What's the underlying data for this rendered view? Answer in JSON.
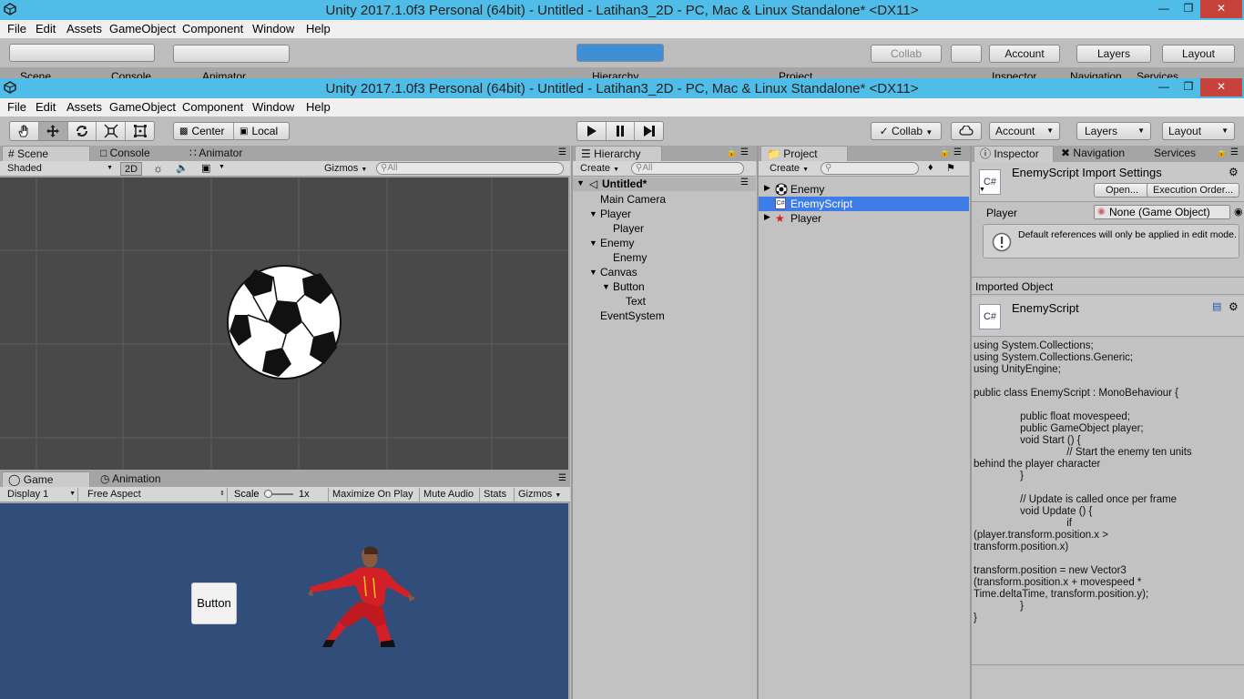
{
  "window": {
    "title": "Unity 2017.1.0f3 Personal (64bit) - Untitled - Latihan3_2D - PC, Mac & Linux Standalone* <DX11>",
    "minimize": "—",
    "maximize": "❐",
    "close": "✕"
  },
  "menu": [
    "File",
    "Edit",
    "Assets",
    "GameObject",
    "Component",
    "Window",
    "Help"
  ],
  "toolbar": {
    "center": "Center",
    "local": "Local",
    "collab": "Collab",
    "account": "Account",
    "layers": "Layers",
    "layout": "Layout"
  },
  "ghost": {
    "tabs": [
      "Scene",
      "Console",
      "Animator",
      "Hierarchy",
      "Project",
      "Inspector",
      "Navigation",
      "Services"
    ]
  },
  "scene": {
    "tabs": [
      "Scene",
      "Console",
      "Animator"
    ],
    "shading": "Shaded",
    "mode2d": "2D",
    "gizmos": "Gizmos",
    "search_placeholder": "All"
  },
  "game": {
    "tabs": [
      "Game",
      "Animation"
    ],
    "display": "Display 1",
    "aspect": "Free Aspect",
    "scale_label": "Scale",
    "scale_value": "1x",
    "maximize": "Maximize On Play",
    "mute": "Mute Audio",
    "stats": "Stats",
    "gizmos": "Gizmos",
    "button_text": "Button"
  },
  "hierarchy": {
    "tab": "Hierarchy",
    "create": "Create",
    "search_placeholder": "All",
    "scene_name": "Untitled*",
    "items": [
      "Main Camera",
      "Player",
      "Player",
      "Enemy",
      "Enemy",
      "Canvas",
      "Button",
      "Text",
      "EventSystem"
    ]
  },
  "project": {
    "tab": "Project",
    "create": "Create",
    "items": [
      "Enemy",
      "EnemyScript",
      "Player"
    ]
  },
  "inspector": {
    "tabs": [
      "Inspector",
      "Navigation",
      "Services"
    ],
    "header": "EnemyScript Import Settings",
    "open": "Open...",
    "exec_order": "Execution Order...",
    "field_label": "Player",
    "field_value": "None (Game Object)",
    "info": "Default references will only be applied in edit mode.",
    "imported_label": "Imported Object",
    "script_name": "EnemyScript",
    "cs_icon": "C#",
    "code": "using System.Collections;\nusing System.Collections.Generic;\nusing UnityEngine;\n\npublic class EnemyScript : MonoBehaviour {\n\n                public float movespeed;\n                public GameObject player;\n                void Start () {\n                                // Start the enemy ten units\nbehind the player character\n                }\n\n                // Update is called once per frame\n                void Update () {\n                                if\n(player.transform.position.x >\ntransform.position.x)\n\ntransform.position = new Vector3\n(transform.position.x + movespeed *\nTime.deltaTime, transform.position.y);\n                }\n}"
  },
  "colors": {
    "title_blue": "#4fbde8",
    "play_active": "#3f8fd6",
    "scene_bg": "#494949",
    "game_bg": "#314d79",
    "selection": "#3e7de7"
  }
}
